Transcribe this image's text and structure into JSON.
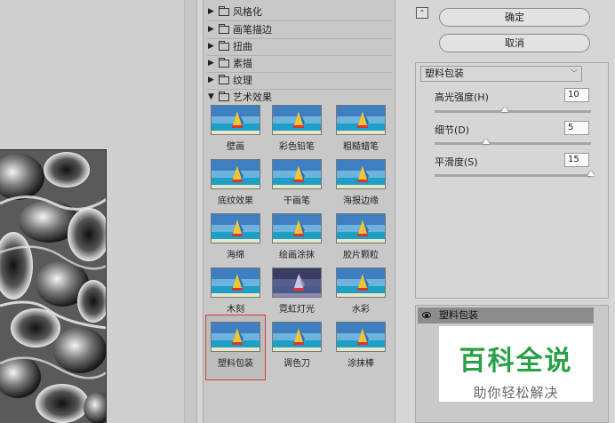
{
  "filter_list": {
    "folders": [
      {
        "label": "风格化",
        "expanded": false
      },
      {
        "label": "画笔描边",
        "expanded": false
      },
      {
        "label": "扭曲",
        "expanded": false
      },
      {
        "label": "素描",
        "expanded": false
      },
      {
        "label": "纹理",
        "expanded": false
      },
      {
        "label": "艺术效果",
        "expanded": true
      }
    ],
    "thumbnails": [
      {
        "label": "壁画"
      },
      {
        "label": "彩色铅笔"
      },
      {
        "label": "粗糙蜡笔"
      },
      {
        "label": "底纹效果"
      },
      {
        "label": "干画笔"
      },
      {
        "label": "海报边缘"
      },
      {
        "label": "海绵"
      },
      {
        "label": "绘画涂抹"
      },
      {
        "label": "胶片颗粒"
      },
      {
        "label": "木刻"
      },
      {
        "label": "霓虹灯光"
      },
      {
        "label": "水彩"
      },
      {
        "label": "塑料包装",
        "selected": true
      },
      {
        "label": "调色刀"
      },
      {
        "label": "涂抹棒"
      }
    ]
  },
  "settings": {
    "ok_label": "确定",
    "cancel_label": "取消",
    "filter_select": "塑料包装",
    "params": [
      {
        "label": "高光强度(H)",
        "value": "10",
        "fraction": 0.45
      },
      {
        "label": "细节(D)",
        "value": "5",
        "fraction": 0.33
      },
      {
        "label": "平滑度(S)",
        "value": "15",
        "fraction": 1.0
      }
    ]
  },
  "layers": {
    "active_layer": "塑料包装"
  },
  "watermark": {
    "title": "百科全说",
    "subtitle": "助你轻松解决"
  },
  "colors": {
    "selection_outline": "#d43c3c",
    "watermark_green": "#27a046"
  }
}
